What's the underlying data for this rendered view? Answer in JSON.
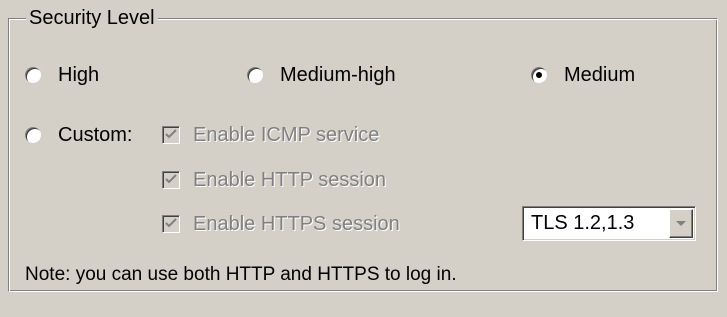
{
  "group": {
    "title": "Security Level"
  },
  "radios": {
    "high": "High",
    "medium_high": "Medium-high",
    "medium": "Medium",
    "custom": "Custom:",
    "selected": "Medium"
  },
  "checkboxes": {
    "icmp": "Enable ICMP service",
    "http": "Enable HTTP session",
    "https": "Enable HTTPS session",
    "checked": [
      true,
      true,
      true
    ],
    "disabled": true
  },
  "tls_select": {
    "value": "TLS 1.2,1.3",
    "disabled": true
  },
  "note": "Note: you can use both HTTP and HTTPS to log in.",
  "colors": {
    "background": "#d4d0c8",
    "disabled_text": "#808080"
  },
  "icons": {
    "radio_selected": "radio-dot",
    "checkbox_checked": "check-mark",
    "dropdown": "chevron-down"
  }
}
